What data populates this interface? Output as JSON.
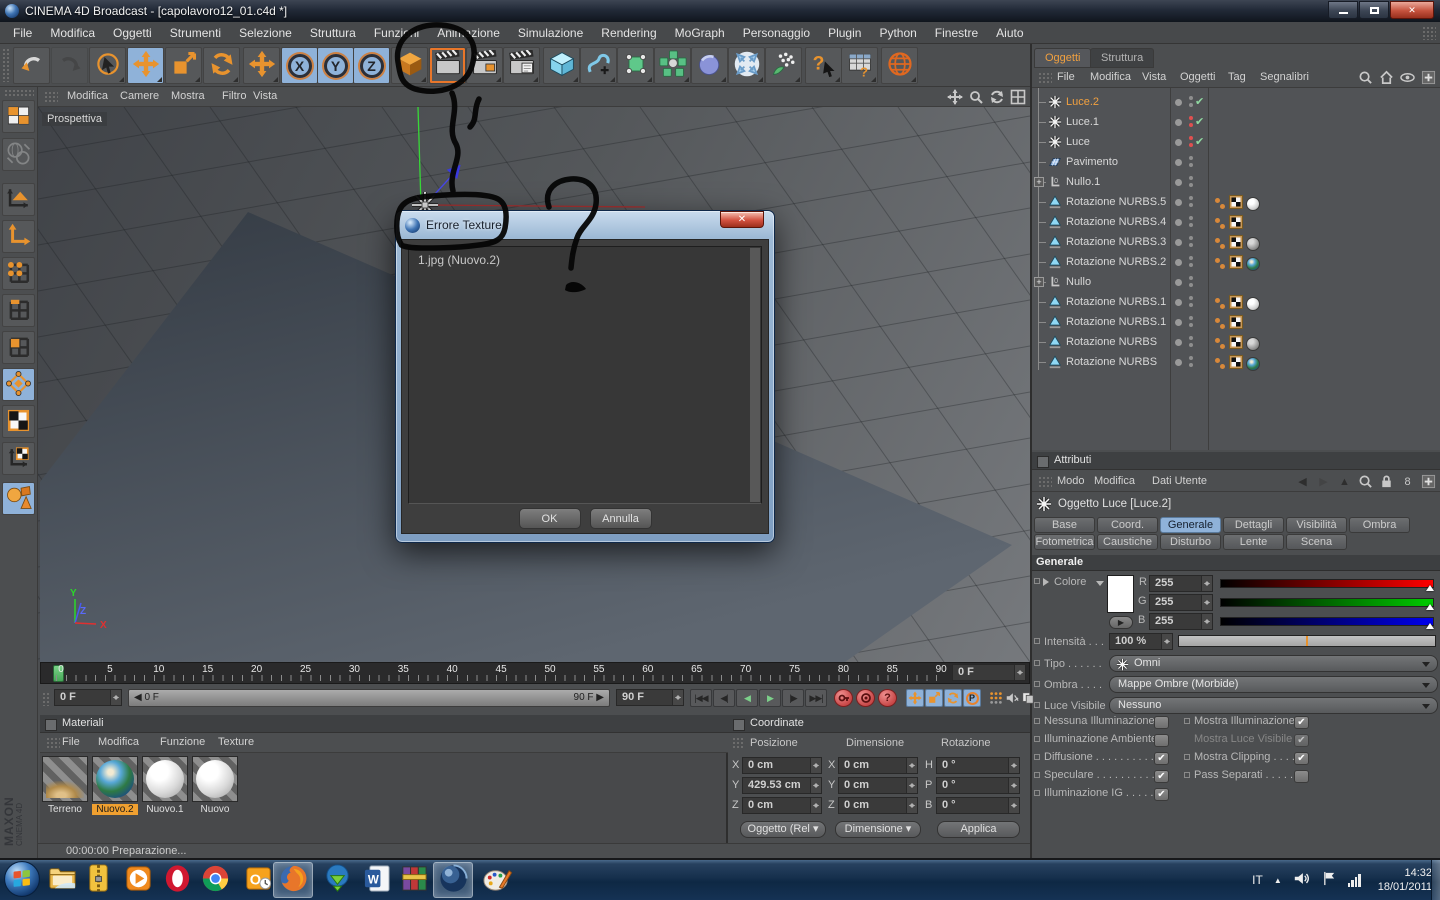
{
  "window": {
    "title": "CINEMA 4D Broadcast - [capolavoro12_01.c4d *]"
  },
  "menubar": {
    "items": [
      "File",
      "Modifica",
      "Oggetti",
      "Strumenti",
      "Selezione",
      "Struttura",
      "Funzioni",
      "Animazione",
      "Simulazione",
      "Rendering",
      "MoGraph",
      "Personaggio",
      "Plugin",
      "Python",
      "Finestre",
      "Aiuto"
    ]
  },
  "toolbar": {
    "items": [
      "undo-icon",
      "redo-icon",
      "live-selection-icon",
      "move-icon",
      "scale-icon",
      "rotate-icon",
      "move-locked-icon",
      "axis-x-icon",
      "axis-y-icon",
      "axis-z-icon",
      "coord-system-icon",
      "render-view-icon",
      "render-picture-icon",
      "render-settings-icon",
      "primitive-cube-icon",
      "spline-icon",
      "hypernurbs-icon",
      "array-icon",
      "metaball-icon",
      "expand-selection-icon",
      "particles-icon",
      "help-icon",
      "commander-icon",
      "globe-icon"
    ],
    "active_items": [
      "move-icon",
      "axis-x-icon",
      "axis-y-icon",
      "axis-z-icon"
    ],
    "outlined_items": [
      "render-view-icon"
    ],
    "disabled_items": [
      "redo-icon"
    ],
    "axis_labels": {
      "axis-x-icon": "X",
      "axis-y-icon": "Y",
      "axis-z-icon": "Z"
    }
  },
  "left_toolbar": {
    "items": [
      "make-editable-icon",
      "use-camera-icon",
      "model-mode-icon",
      "object-axis-icon",
      "points-mode-icon",
      "edges-mode-icon",
      "polygons-mode-icon",
      "texture-edit-icon",
      "texture-mode-icon",
      "texture-axis-icon",
      "snap-icon"
    ],
    "active_items": [
      "texture-edit-icon",
      "snap-icon"
    ],
    "disabled_items": [
      "use-camera-icon"
    ]
  },
  "viewport": {
    "menu": [
      "Modifica",
      "Camere",
      "Mostra",
      "Filtro",
      "Vista"
    ],
    "camera_label": "Prospettiva",
    "corner_icons": [
      "vp-pan-icon",
      "vp-zoom-icon",
      "vp-rotate-icon",
      "vp-toggle-icon"
    ]
  },
  "dialog": {
    "title": "Errore Texture",
    "items": [
      "1.jpg (Nuovo.2)"
    ],
    "ok_label": "OK",
    "cancel_label": "Annulla"
  },
  "object_manager": {
    "tabs": [
      {
        "label": "Oggetti",
        "active": true
      },
      {
        "label": "Struttura",
        "active": false
      }
    ],
    "menu": [
      "File",
      "Modifica",
      "Vista",
      "Oggetti",
      "Tag",
      "Segnalibri"
    ],
    "menu_icons": [
      "search-icon",
      "home-icon",
      "eye-icon",
      "add-panel-icon"
    ],
    "objects": [
      {
        "name": "Luce.2",
        "icon": "light-icon",
        "selected": true,
        "dots": "gray",
        "check": true,
        "tags": []
      },
      {
        "name": "Luce.1",
        "icon": "light-icon",
        "selected": false,
        "dots": "red",
        "check": true,
        "tags": []
      },
      {
        "name": "Luce",
        "icon": "light-icon",
        "selected": false,
        "dots": "red",
        "check": true,
        "tags": []
      },
      {
        "name": "Pavimento",
        "icon": "floor-icon",
        "selected": false,
        "dots": "gray",
        "check": false,
        "tags": []
      },
      {
        "name": "Nullo.1",
        "icon": "null-icon",
        "selected": false,
        "expand": true,
        "dots": "gray",
        "check": false,
        "tags": []
      },
      {
        "name": "Rotazione NURBS.5",
        "icon": "nurbs-icon",
        "selected": false,
        "dots": "gray",
        "check": false,
        "tags": [
          "orange-dots-tag",
          "texture-tag",
          "material-white-tag"
        ]
      },
      {
        "name": "Rotazione NURBS.4",
        "icon": "nurbs-icon",
        "selected": false,
        "dots": "gray",
        "check": false,
        "tags": [
          "orange-dots-tag",
          "texture-tag"
        ]
      },
      {
        "name": "Rotazione NURBS.3",
        "icon": "nurbs-icon",
        "selected": false,
        "dots": "gray",
        "check": false,
        "tags": [
          "orange-dots-tag",
          "texture-tag",
          "material-gray-tag"
        ]
      },
      {
        "name": "Rotazione NURBS.2",
        "icon": "nurbs-icon",
        "selected": false,
        "dots": "gray",
        "check": false,
        "tags": [
          "orange-dots-tag",
          "texture-tag",
          "material-earth-tag"
        ]
      },
      {
        "name": "Nullo",
        "icon": "null-icon",
        "selected": false,
        "expand": true,
        "dots": "gray",
        "check": false,
        "tags": []
      },
      {
        "name": "Rotazione NURBS.1",
        "icon": "nurbs-icon",
        "selected": false,
        "dots": "gray",
        "check": false,
        "tags": [
          "orange-dots-tag",
          "texture-tag",
          "material-white-tag"
        ]
      },
      {
        "name": "Rotazione NURBS.1",
        "icon": "nurbs-icon",
        "selected": false,
        "dots": "gray",
        "check": false,
        "tags": [
          "orange-dots-tag",
          "texture-tag"
        ]
      },
      {
        "name": "Rotazione NURBS",
        "icon": "nurbs-icon",
        "selected": false,
        "dots": "gray",
        "check": false,
        "tags": [
          "orange-dots-tag",
          "texture-tag",
          "material-gray-tag"
        ]
      },
      {
        "name": "Rotazione NURBS",
        "icon": "nurbs-icon",
        "selected": false,
        "dots": "gray",
        "check": false,
        "tags": [
          "orange-dots-tag",
          "texture-tag",
          "material-earth-tag"
        ]
      }
    ]
  },
  "attributes": {
    "panel_title": "Attributi",
    "menu": [
      "Modo",
      "Modifica",
      "Dati Utente"
    ],
    "menu_icons": [
      "back-icon",
      "forward-icon",
      "up-icon",
      "search-icon",
      "lock-icon",
      "history-icon",
      "add-panel-icon"
    ],
    "object_title": "Oggetto Luce [Luce.2]",
    "tabs_row1": [
      {
        "label": "Base"
      },
      {
        "label": "Coord."
      },
      {
        "label": "Generale",
        "active": true
      },
      {
        "label": "Dettagli"
      },
      {
        "label": "Visibilità"
      },
      {
        "label": "Ombra"
      }
    ],
    "tabs_row2": [
      {
        "label": "Fotometrica"
      },
      {
        "label": "Caustiche"
      },
      {
        "label": "Disturbo"
      },
      {
        "label": "Lente"
      },
      {
        "label": "Scena"
      }
    ],
    "section_title": "Generale",
    "color": {
      "label": "Colore",
      "r_label": "R",
      "g_label": "G",
      "b_label": "B",
      "r": "255",
      "g": "255",
      "b": "255"
    },
    "intensity": {
      "label": "Intensità . . .",
      "value": "100 %"
    },
    "tipo": {
      "label": "Tipo . . . . . .",
      "value": "Omni"
    },
    "ombra": {
      "label": "Ombra . . . .",
      "value": "Mappe Ombre (Morbide)"
    },
    "luce_visibile": {
      "label": "Luce Visibile",
      "value": "Nessuno"
    },
    "checks_left": [
      {
        "label": "Nessuna Illuminazione",
        "mark": "",
        "disabled": false
      },
      {
        "label": "Illuminazione Ambiente",
        "mark": "",
        "disabled": false
      },
      {
        "label": "Diffusione . . . . . . . . . .",
        "mark": "✔",
        "disabled": false
      },
      {
        "label": "Speculare . . . . . . . . . .",
        "mark": "✔",
        "disabled": false
      },
      {
        "label": "Illuminazione IG . . . . .",
        "mark": "✔",
        "disabled": false
      }
    ],
    "checks_right": [
      {
        "label": "Mostra Illuminazione",
        "mark": "✔",
        "disabled": false
      },
      {
        "label": "Mostra Luce Visibile",
        "mark": "✔",
        "disabled": true
      },
      {
        "label": "Mostra Clipping . . . .",
        "mark": "✔",
        "disabled": false
      },
      {
        "label": "Pass Separati . . . . .",
        "mark": "",
        "disabled": false
      }
    ]
  },
  "timeline": {
    "ticks": [
      "0",
      "5",
      "10",
      "15",
      "20",
      "25",
      "30",
      "35",
      "40",
      "45",
      "50",
      "55",
      "60",
      "65",
      "70",
      "75",
      "80",
      "85",
      "90"
    ],
    "current_frame": "0 F",
    "range_start": "0 F",
    "range_end": "90 F",
    "range_bar_left": "0 F",
    "range_bar_right": "90 F",
    "playback": [
      "skip-start-icon",
      "step-back-icon",
      "play-backward-icon",
      "play-forward-icon",
      "step-forward-icon",
      "skip-end-icon"
    ],
    "record": [
      "record-position-icon",
      "record-active-icon",
      "record-help-icon"
    ],
    "modes": [
      "key-move-icon",
      "key-scale-icon",
      "key-rotate-icon",
      "key-parameter-icon",
      "keyframe-dots-icon",
      "sound-icon",
      "doc-icon"
    ]
  },
  "materials": {
    "panel_title": "Materiali",
    "menu": [
      "File",
      "Modifica",
      "Funzione",
      "Texture"
    ],
    "items": [
      {
        "name": "Terreno",
        "thumb": "terrain",
        "selected": false
      },
      {
        "name": "Nuovo.2",
        "thumb": "earth",
        "selected": true
      },
      {
        "name": "Nuovo.1",
        "thumb": "white",
        "selected": false
      },
      {
        "name": "Nuovo",
        "thumb": "white",
        "selected": false
      }
    ]
  },
  "coordinates": {
    "panel_title": "Coordinate",
    "col1": "Posizione",
    "col2": "Dimensione",
    "col3": "Rotazione",
    "labels": {
      "p1": "X",
      "p2": "Y",
      "p3": "Z",
      "d1": "X",
      "d2": "Y",
      "d3": "Z",
      "r1": "H",
      "r2": "P",
      "r3": "B"
    },
    "pos": {
      "x": "0 cm",
      "y": "429.53 cm",
      "z": "0 cm"
    },
    "dim": {
      "x": "0 cm",
      "y": "0 cm",
      "z": "0 cm"
    },
    "rot": {
      "h": "0 °",
      "p": "0 °",
      "b": "0 °"
    },
    "mode_object": "Oggetto (Rel",
    "mode_size": "Dimensione",
    "apply_label": "Applica"
  },
  "statusbar": {
    "text": "00:00:00 Preparazione..."
  },
  "branding": {
    "line1": "MAXON",
    "line2": "CINEMA 4D"
  },
  "taskbar": {
    "icons": [
      "start-button",
      "explorer-icon",
      "winzip-icon",
      "media-player-icon",
      "opera-icon",
      "chrome-icon",
      "outlook-icon",
      "firefox-icon",
      "download-manager-icon",
      "word-icon",
      "winrar-icon",
      "cinema4d-icon",
      "paint-icon"
    ],
    "active_icons": [
      "firefox-icon",
      "cinema4d-icon"
    ],
    "tray": {
      "language": "IT",
      "time": "14:32",
      "date": "18/01/2011"
    }
  },
  "colors": {
    "accent_orange": "#e8932e",
    "selection_blue": "#8fb2d9",
    "check_green": "#86d89a",
    "record_red": "#d85050"
  }
}
